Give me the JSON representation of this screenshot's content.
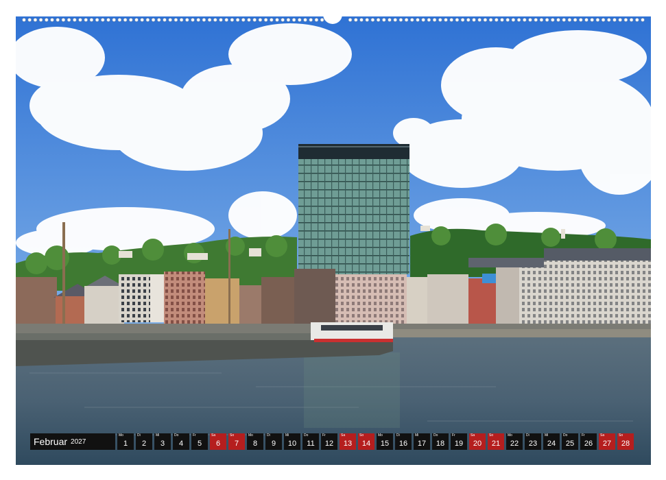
{
  "calendar": {
    "month": "Februar",
    "year": "2027",
    "days": [
      {
        "wd": "Mo",
        "num": "1",
        "weekend": false
      },
      {
        "wd": "Di",
        "num": "2",
        "weekend": false
      },
      {
        "wd": "Mi",
        "num": "3",
        "weekend": false
      },
      {
        "wd": "Do",
        "num": "4",
        "weekend": false
      },
      {
        "wd": "Fr",
        "num": "5",
        "weekend": false
      },
      {
        "wd": "Sa",
        "num": "6",
        "weekend": true
      },
      {
        "wd": "So",
        "num": "7",
        "weekend": true
      },
      {
        "wd": "Mo",
        "num": "8",
        "weekend": false
      },
      {
        "wd": "Di",
        "num": "9",
        "weekend": false
      },
      {
        "wd": "Mi",
        "num": "10",
        "weekend": false
      },
      {
        "wd": "Do",
        "num": "11",
        "weekend": false
      },
      {
        "wd": "Fr",
        "num": "12",
        "weekend": false
      },
      {
        "wd": "Sa",
        "num": "13",
        "weekend": true
      },
      {
        "wd": "So",
        "num": "14",
        "weekend": true
      },
      {
        "wd": "Mo",
        "num": "15",
        "weekend": false
      },
      {
        "wd": "Di",
        "num": "16",
        "weekend": false
      },
      {
        "wd": "Mi",
        "num": "17",
        "weekend": false
      },
      {
        "wd": "Do",
        "num": "18",
        "weekend": false
      },
      {
        "wd": "Fr",
        "num": "19",
        "weekend": false
      },
      {
        "wd": "Sa",
        "num": "20",
        "weekend": true
      },
      {
        "wd": "So",
        "num": "21",
        "weekend": true
      },
      {
        "wd": "Mo",
        "num": "22",
        "weekend": false
      },
      {
        "wd": "Di",
        "num": "23",
        "weekend": false
      },
      {
        "wd": "Mi",
        "num": "24",
        "weekend": false
      },
      {
        "wd": "Do",
        "num": "25",
        "weekend": false
      },
      {
        "wd": "Fr",
        "num": "26",
        "weekend": false
      },
      {
        "wd": "Sa",
        "num": "27",
        "weekend": true
      },
      {
        "wd": "So",
        "num": "28",
        "weekend": true
      }
    ]
  },
  "colors": {
    "weekday_box": "#111111",
    "weekend_box": "#b51e1e",
    "sky": "#3a7bd6",
    "river": "#4a6173"
  }
}
